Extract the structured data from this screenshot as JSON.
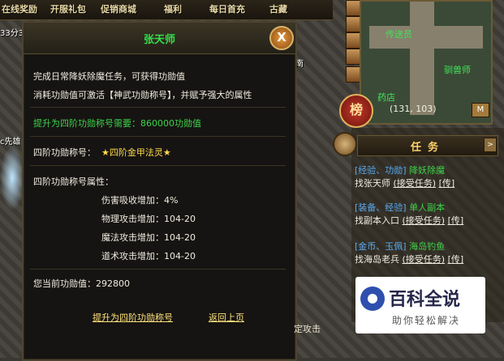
{
  "topbar": [
    "在线奖励",
    "开服礼包",
    "促销商城",
    "福利",
    "每日首充",
    "古藏"
  ],
  "left_texts": [
    "33分3",
    "c先雄",
    "南"
  ],
  "dialog": {
    "title": "张天师",
    "close": "X",
    "line1": "完成日常降妖除魔任务，可获得功勋值",
    "line2": "消耗功勋值可激活【神武功勋称号】，并赋予强大的属性",
    "upgrade_need": "提升为四阶功勋称号需要：860000功勋值",
    "title_label": "四阶功勋称号：",
    "title_value": "★四阶金甲法灵★",
    "attr_header": "四阶功勋称号属性：",
    "attrs": [
      "伤害吸收增加：4%",
      "物理攻击增加：104-20",
      "魔法攻击增加：104-20",
      "道术攻击增加：104-20"
    ],
    "current": "您当前功勋值：292800",
    "btn_upgrade": "提升为四阶功勋称号",
    "btn_back": "返回上页"
  },
  "minimap": {
    "labels": [
      "传送员",
      "驯兽师",
      "药店"
    ],
    "coords": "(131, 103)",
    "rank_btn": "榜",
    "map_btn": "M"
  },
  "task_panel": {
    "title": "任务",
    "arrow": ">",
    "tasks": [
      {
        "tag": "[经验、功勋]",
        "name": "降妖除魔",
        "who": "找张天师",
        "accept": "(接受任务)",
        "send": "[传]"
      },
      {
        "tag": "[装备、经验]",
        "name": "单人副本",
        "who": "找副本入口",
        "accept": "(接受任务)",
        "send": "[传]"
      },
      {
        "tag": "[金币、玉佩]",
        "name": "海岛钓鱼",
        "who": "找海岛老兵",
        "accept": "(接受任务)",
        "send": "[传]"
      }
    ]
  },
  "bottom_text": "定攻击",
  "watermark": {
    "big": "百科全说",
    "small": "助你轻松解决"
  }
}
